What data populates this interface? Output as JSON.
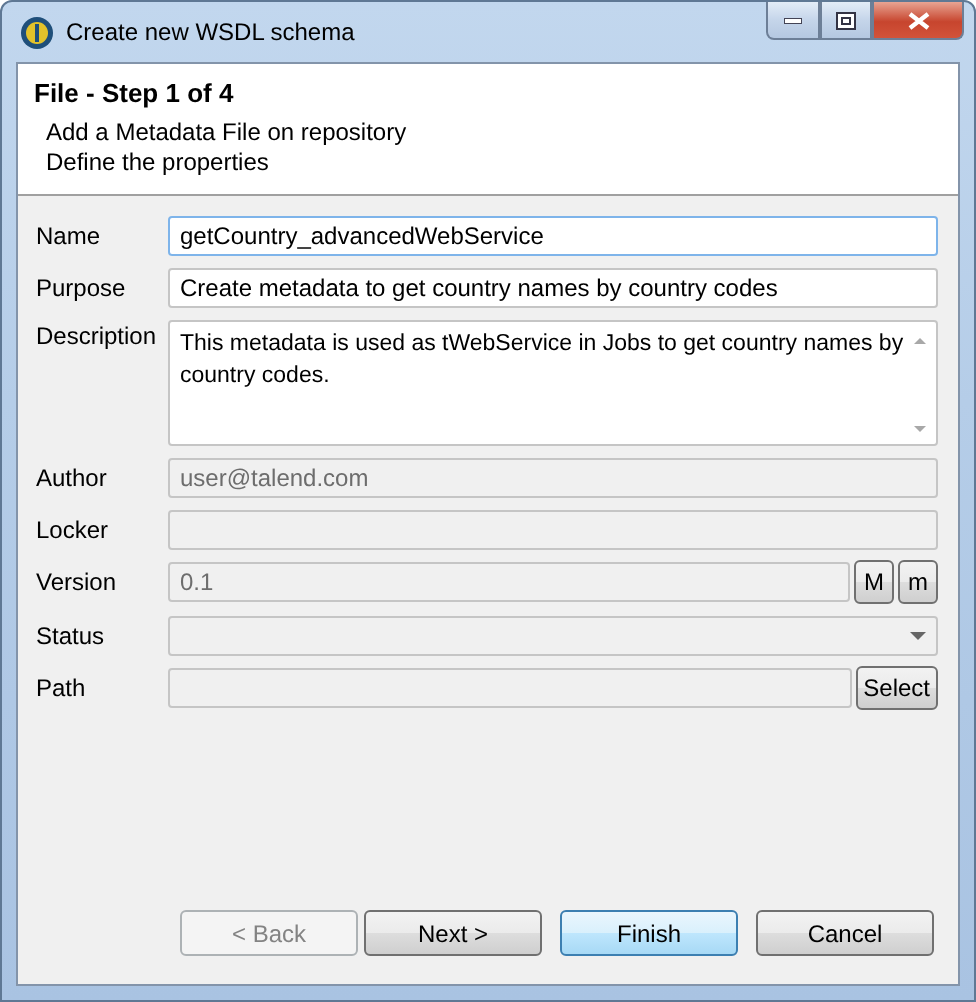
{
  "window": {
    "title": "Create new WSDL schema"
  },
  "header": {
    "title": "File - Step 1 of 4",
    "lines": [
      "Add a Metadata File on repository",
      "Define the properties"
    ]
  },
  "fields": [
    {
      "label": "Name",
      "kind": "text",
      "value": "getCountry_advancedWebService",
      "disabled": false,
      "focused": true
    },
    {
      "label": "Purpose",
      "kind": "text",
      "value": "Create metadata to get country names by country codes",
      "disabled": false,
      "focused": false
    },
    {
      "label": "Description",
      "kind": "textarea",
      "value": "This metadata is used as tWebService in Jobs to get country names by country codes.",
      "disabled": false,
      "focused": false
    },
    {
      "label": "Author",
      "kind": "text",
      "value": "user@talend.com",
      "disabled": true,
      "focused": false
    },
    {
      "label": "Locker",
      "kind": "text",
      "disabled": true,
      "focused": false
    },
    {
      "label": "Version",
      "kind": "text",
      "value": "0.1",
      "disabled": true,
      "focused": false,
      "buttons": [
        "M",
        "m"
      ]
    },
    {
      "label": "Status",
      "kind": "combo",
      "disabled": true,
      "focused": false
    },
    {
      "label": "Path",
      "kind": "text",
      "disabled": true,
      "focused": false,
      "buttons": [
        "Select"
      ]
    }
  ],
  "buttons": [
    {
      "label": "< Back",
      "disabled": true,
      "default": false
    },
    {
      "label": "Next >",
      "disabled": false,
      "default": false
    },
    {
      "label": "Finish",
      "disabled": false,
      "default": true
    },
    {
      "label": "Cancel",
      "disabled": false,
      "default": false
    }
  ]
}
